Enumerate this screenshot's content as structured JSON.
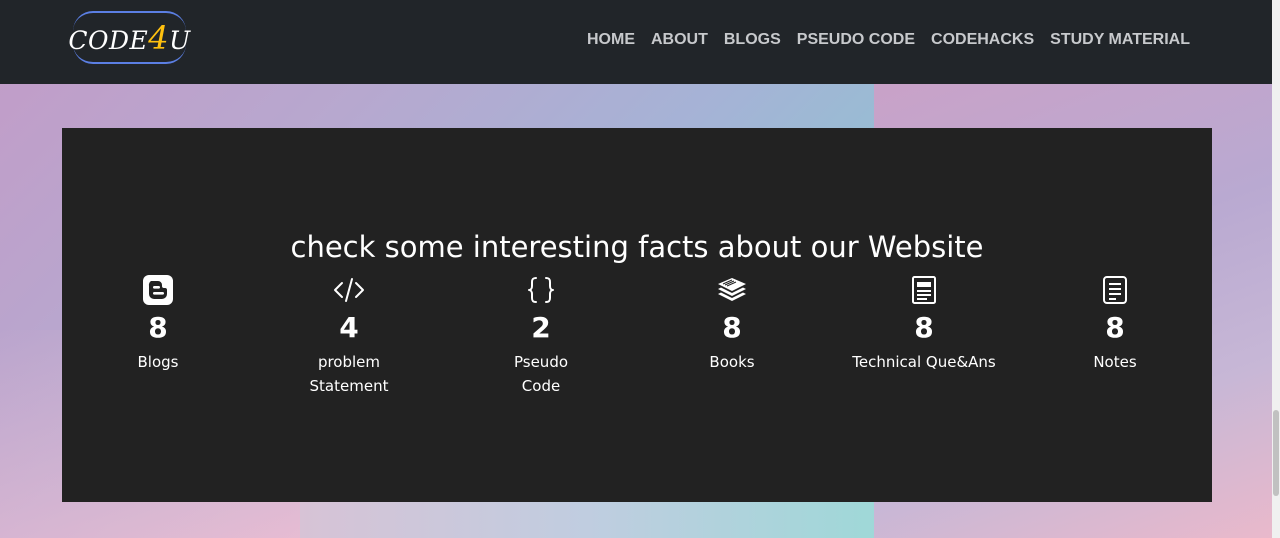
{
  "brand": {
    "prefix": "CODE",
    "accent": "4",
    "suffix": "U",
    "accent_color": "#ffc10f",
    "ring_color": "#5b7fe3"
  },
  "nav": {
    "items": [
      {
        "label": "HOME"
      },
      {
        "label": "ABOUT"
      },
      {
        "label": "BLOGS"
      },
      {
        "label": "PSEUDO CODE"
      },
      {
        "label": "CODEHACKS"
      },
      {
        "label": "STUDY MATERIAL"
      }
    ]
  },
  "facts": {
    "title": "check some interesting facts about our Website",
    "items": [
      {
        "icon": "blogger-icon",
        "count": "8",
        "label": "Blogs"
      },
      {
        "icon": "code-icon",
        "count": "4",
        "label": "problem Statement"
      },
      {
        "icon": "braces-icon",
        "count": "2",
        "label": "Pseudo Code"
      },
      {
        "icon": "books-icon",
        "count": "8",
        "label": "Books"
      },
      {
        "icon": "newspaper-icon",
        "count": "8",
        "label": "Technical Que&Ans"
      },
      {
        "icon": "notes-icon",
        "count": "8",
        "label": "Notes"
      }
    ]
  },
  "colors": {
    "navbar": "#212529",
    "panel": "#222222",
    "nav_text": "#c7c9cc"
  }
}
